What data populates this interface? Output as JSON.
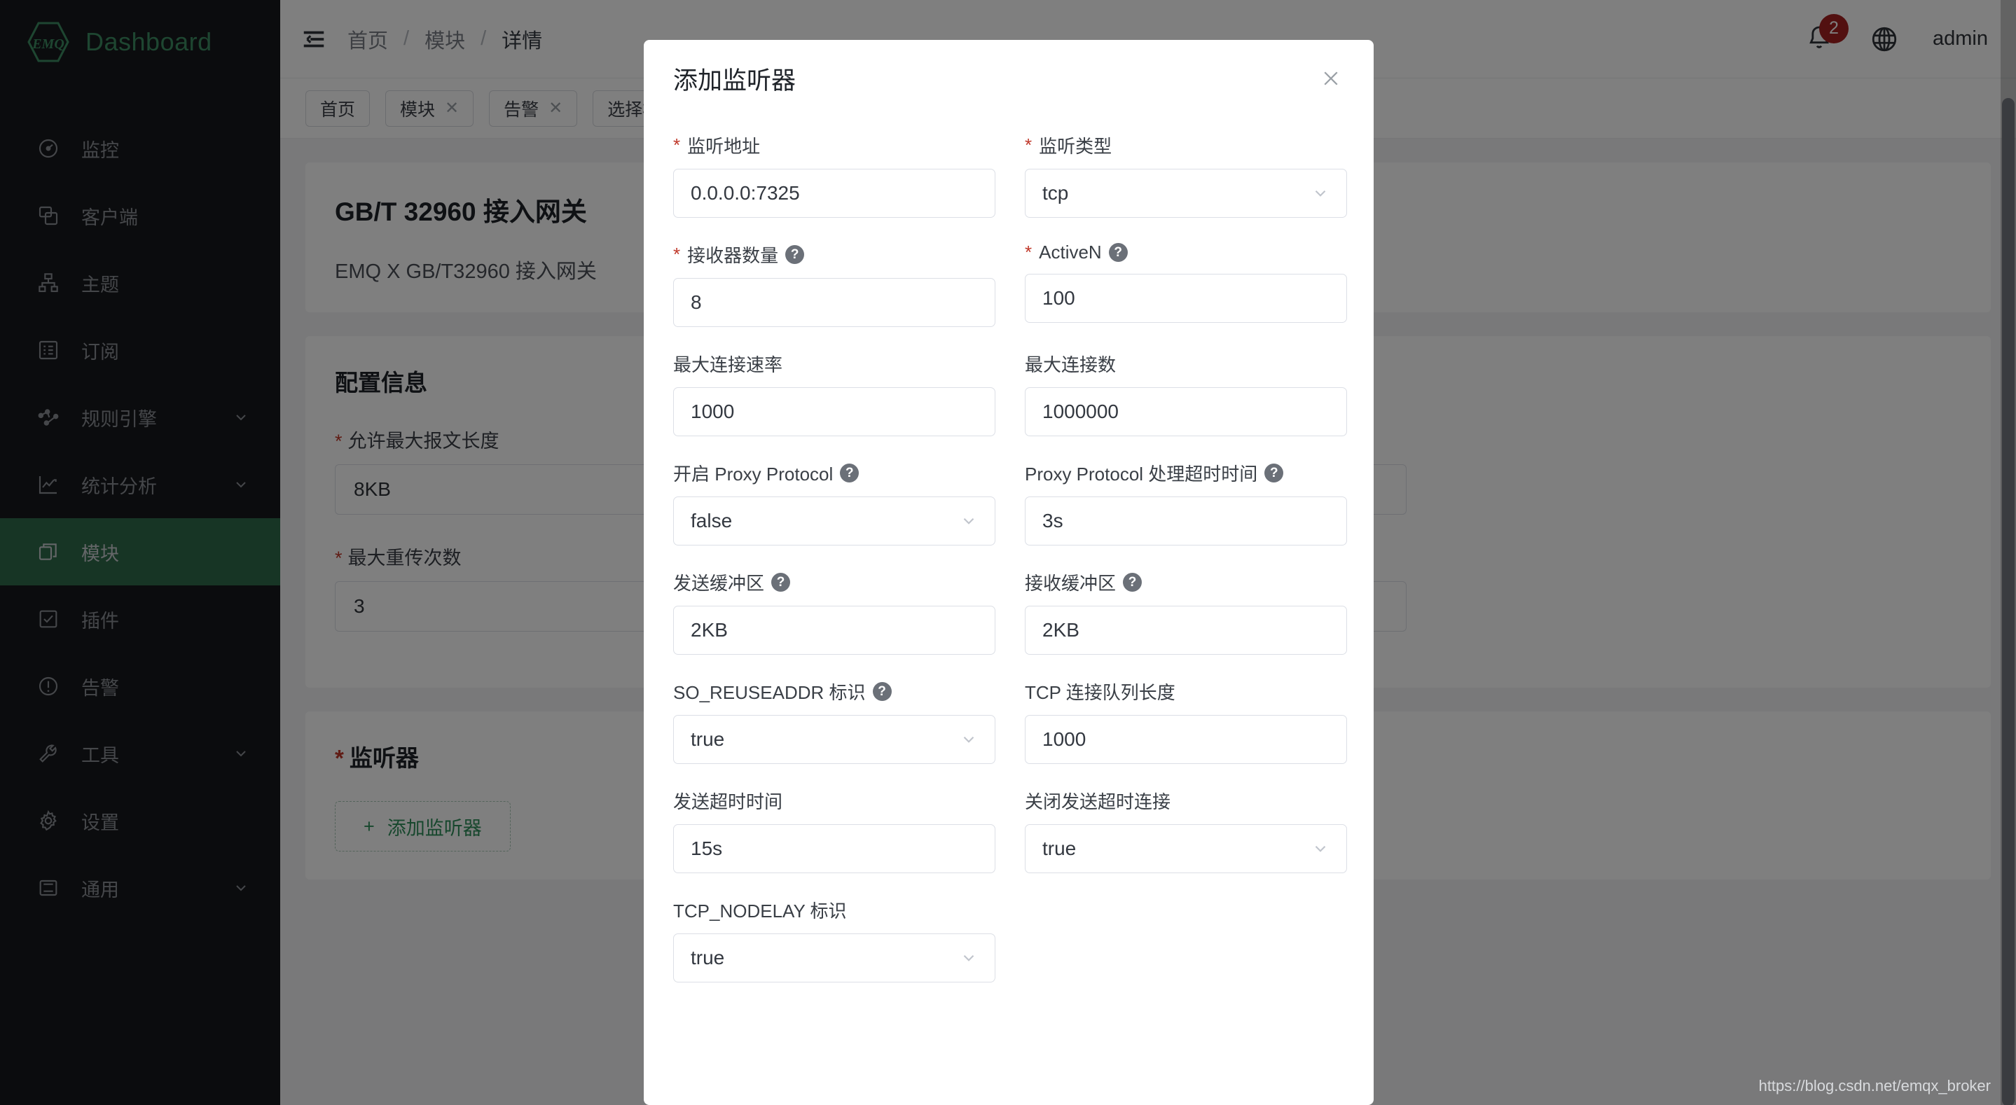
{
  "brand": {
    "logo_text": "EMQ",
    "title": "Dashboard"
  },
  "sidebar": {
    "items": [
      {
        "label": "监控",
        "icon": "dashboard-gauge-icon",
        "has_caret": false,
        "active": false
      },
      {
        "label": "客户端",
        "icon": "clients-icon",
        "has_caret": false,
        "active": false
      },
      {
        "label": "主题",
        "icon": "topics-tree-icon",
        "has_caret": false,
        "active": false
      },
      {
        "label": "订阅",
        "icon": "subscriptions-list-icon",
        "has_caret": false,
        "active": false
      },
      {
        "label": "规则引擎",
        "icon": "rule-engine-nodes-icon",
        "has_caret": true,
        "active": false
      },
      {
        "label": "统计分析",
        "icon": "analytics-chart-icon",
        "has_caret": true,
        "active": false
      },
      {
        "label": "模块",
        "icon": "modules-stack-icon",
        "has_caret": false,
        "active": true
      },
      {
        "label": "插件",
        "icon": "plugins-check-icon",
        "has_caret": false,
        "active": false
      },
      {
        "label": "告警",
        "icon": "alarm-exclamation-icon",
        "has_caret": false,
        "active": false
      },
      {
        "label": "工具",
        "icon": "tools-wrench-icon",
        "has_caret": true,
        "active": false
      },
      {
        "label": "设置",
        "icon": "settings-gear-icon",
        "has_caret": false,
        "active": false
      },
      {
        "label": "通用",
        "icon": "general-server-icon",
        "has_caret": true,
        "active": false
      }
    ]
  },
  "topbar": {
    "menu_icon": "collapse-menu-icon",
    "breadcrumb": [
      "首页",
      "模块",
      "详情"
    ],
    "separator": "/",
    "notification_icon": "bell-icon",
    "notification_count": "2",
    "language_icon": "globe-icon",
    "user": "admin"
  },
  "tabs": [
    {
      "label": "首页",
      "closable": false
    },
    {
      "label": "模块",
      "closable": true
    },
    {
      "label": "告警",
      "closable": true
    },
    {
      "label": "选择模块",
      "closable": true
    }
  ],
  "page": {
    "gateway_title": "GB/T 32960 接入网关",
    "gateway_subtitle": "EMQ X GB/T32960 接入网关",
    "config_section_title": "配置信息",
    "fields": [
      {
        "label": "允许最大报文长度",
        "required": true,
        "value": "8KB"
      },
      {
        "label": "最大重传次数",
        "required": true,
        "value": "3"
      }
    ],
    "listener_section_title": "监听器",
    "listener_required": true,
    "add_listener_button": "添加监听器",
    "add_listener_icon": "plus-icon"
  },
  "modal": {
    "title": "添加监听器",
    "close_icon": "close-icon",
    "rows": [
      [
        {
          "label": "监听地址",
          "required": true,
          "help": false,
          "value": "0.0.0.0:7325",
          "type": "input"
        },
        {
          "label": "监听类型",
          "required": true,
          "help": false,
          "value": "tcp",
          "type": "select"
        }
      ],
      [
        {
          "label": "接收器数量",
          "required": true,
          "help": true,
          "value": "8",
          "type": "input"
        },
        {
          "label": "ActiveN",
          "required": true,
          "help": true,
          "value": "100",
          "type": "input"
        }
      ],
      [
        {
          "label": "最大连接速率",
          "required": false,
          "help": false,
          "value": "1000",
          "type": "input"
        },
        {
          "label": "最大连接数",
          "required": false,
          "help": false,
          "value": "1000000",
          "type": "input"
        }
      ],
      [
        {
          "label": "开启 Proxy Protocol",
          "required": false,
          "help": true,
          "value": "false",
          "type": "select"
        },
        {
          "label": "Proxy Protocol 处理超时时间",
          "required": false,
          "help": true,
          "value": "3s",
          "type": "input"
        }
      ],
      [
        {
          "label": "发送缓冲区",
          "required": false,
          "help": true,
          "value": "2KB",
          "type": "input"
        },
        {
          "label": "接收缓冲区",
          "required": false,
          "help": true,
          "value": "2KB",
          "type": "input"
        }
      ],
      [
        {
          "label": "SO_REUSEADDR 标识",
          "required": false,
          "help": true,
          "value": "true",
          "type": "select"
        },
        {
          "label": "TCP 连接队列长度",
          "required": false,
          "help": false,
          "value": "1000",
          "type": "input"
        }
      ],
      [
        {
          "label": "发送超时时间",
          "required": false,
          "help": false,
          "value": "15s",
          "type": "input"
        },
        {
          "label": "关闭发送超时连接",
          "required": false,
          "help": false,
          "value": "true",
          "type": "select"
        }
      ],
      [
        {
          "label": "TCP_NODELAY 标识",
          "required": false,
          "help": false,
          "value": "true",
          "type": "select"
        }
      ]
    ]
  },
  "watermark": "https://blog.csdn.net/emqx_broker",
  "colors": {
    "brand_green": "#3d8d62",
    "active_nav": "#2f6b4b",
    "sidebar_bg": "#17181c",
    "badge_red": "#a52020",
    "required_red": "#c0392b"
  }
}
